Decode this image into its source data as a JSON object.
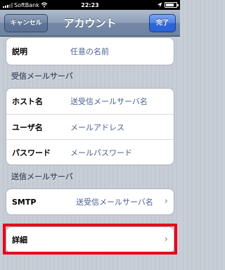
{
  "status_bar": {
    "carrier": "SoftBank",
    "time": "22:23"
  },
  "nav": {
    "cancel_label": "キャンセル",
    "title": "アカウント",
    "done_label": "完了"
  },
  "description_row": {
    "label": "説明",
    "value": "任意の名前"
  },
  "incoming": {
    "header": "受信メールサーバ",
    "rows": [
      {
        "label": "ホスト名",
        "value": "送受信メールサーバ名"
      },
      {
        "label": "ユーザ名",
        "value": "メールアドレス"
      },
      {
        "label": "パスワード",
        "value": "メールパスワード"
      }
    ]
  },
  "outgoing": {
    "header": "送信メールサーバ",
    "smtp_label": "SMTP",
    "smtp_value": "送受信メールサーバ名"
  },
  "details_row": {
    "label": "詳細"
  },
  "colors": {
    "highlight": "#e8001c",
    "value_text": "#4a5f8e",
    "section_header": "#4c566c"
  },
  "icons": [
    "signal-bars-icon",
    "wifi-icon",
    "location-arrow-icon",
    "battery-icon",
    "chevron-right-icon"
  ]
}
